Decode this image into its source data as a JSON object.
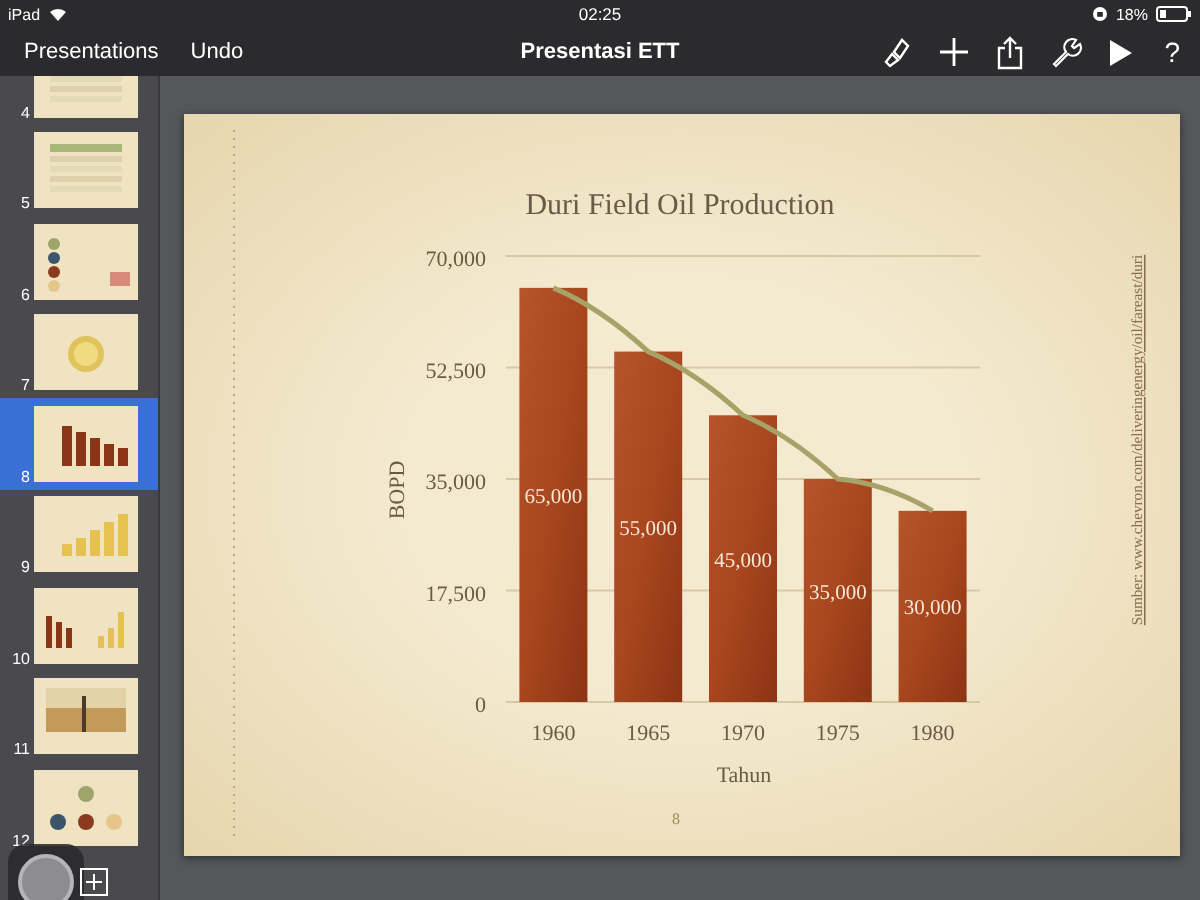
{
  "status_bar": {
    "device": "iPad",
    "time": "02:25",
    "battery": "18%"
  },
  "toolbar": {
    "buttons": [
      "Presentations",
      "Undo"
    ],
    "title": "Presentasi ETT",
    "help": "?"
  },
  "slides": [
    {
      "number": "4",
      "kind": "table",
      "selected": false
    },
    {
      "number": "5",
      "kind": "table",
      "selected": false
    },
    {
      "number": "6",
      "kind": "list",
      "selected": false
    },
    {
      "number": "7",
      "kind": "badge",
      "selected": false
    },
    {
      "number": "8",
      "kind": "bar-chart",
      "selected": true
    },
    {
      "number": "9",
      "kind": "rising-chart",
      "selected": false
    },
    {
      "number": "10",
      "kind": "two-charts",
      "selected": false
    },
    {
      "number": "11",
      "kind": "photo",
      "selected": false
    },
    {
      "number": "12",
      "kind": "circles",
      "selected": false
    }
  ],
  "slide": {
    "page_number": "8",
    "source": "Sumber: www.chevron.com/deliveringenergy/oil/fareast/duri",
    "chart_data": {
      "type": "bar",
      "title": "Duri Field Oil Production",
      "xlabel": "Tahun",
      "ylabel": "BOPD",
      "categories": [
        "1960",
        "1965",
        "1970",
        "1975",
        "1980"
      ],
      "grid": true,
      "series": [
        {
          "type": "bar",
          "color": "#a8461e",
          "values": [
            65000,
            55000,
            45000,
            35000,
            30000
          ]
        },
        {
          "type": "line",
          "color": "#a7a268",
          "values": [
            65000,
            55000,
            45000,
            35000,
            30000
          ]
        }
      ],
      "ylim": [
        0,
        70000
      ],
      "yticks": [
        {
          "value": 0,
          "label": "0"
        },
        {
          "value": 17500,
          "label": "17,500"
        },
        {
          "value": 35000,
          "label": "35,000"
        },
        {
          "value": 52500,
          "label": "52,500"
        },
        {
          "value": 70000,
          "label": "70,000"
        }
      ],
      "value_labels": [
        "65,000",
        "55,000",
        "45,000",
        "35,000",
        "30,000"
      ]
    }
  }
}
